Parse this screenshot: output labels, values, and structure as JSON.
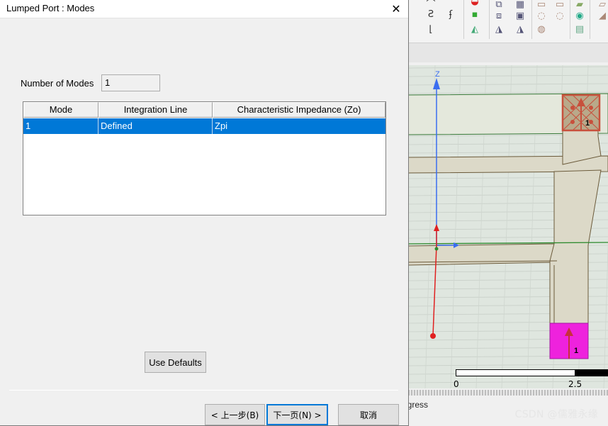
{
  "dialog": {
    "title": "Lumped Port : Modes",
    "close_glyph": "✕",
    "number_of_modes_label": "Number of Modes",
    "number_of_modes_value": "1",
    "table": {
      "columns": [
        "Mode",
        "Integration Line",
        "Characteristic Impedance (Zo)"
      ],
      "rows": [
        {
          "mode": "1",
          "integration_line": "Defined",
          "impedance": "Zpi",
          "selected": true
        }
      ]
    },
    "use_defaults_label": "Use Defaults",
    "back_label": "< 上一步(B)",
    "next_label": "下一页(N) >",
    "cancel_label": "取消"
  },
  "modeler": {
    "axis_z_label": "Z",
    "port_labels": [
      "1",
      "1"
    ],
    "ruler": {
      "labels": [
        "0",
        "2.5"
      ]
    },
    "status_text": "ogress",
    "watermark": "CSDN @儒雅永缘",
    "colors": {
      "selection": "#0078d7",
      "port_top": "#c8503c",
      "port_bottom": "#ee22dd",
      "axis_z": "#3a6df0",
      "axis_x": "#2d8a2d",
      "axis_red": "#e02020"
    }
  }
}
